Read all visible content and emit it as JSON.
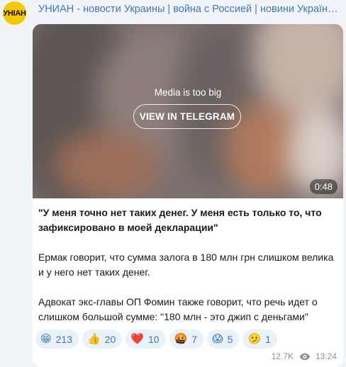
{
  "channel": {
    "name": "УНИАН - новости Украины | война с Россией | новини України...",
    "avatar_text": "УНІАН",
    "accent_color": "#3d7ab8",
    "avatar_color": "#f5c800"
  },
  "media": {
    "notice": "Media is too big",
    "button_label": "VIEW IN TELEGRAM",
    "duration": "0:48"
  },
  "post": {
    "paragraph1": "\"У меня точно нет таких денег. У меня есть только то, что зафиксировано в моей декларации\"",
    "paragraph2": "Ермак говорит, что сумма залога в 180 млн грн слишком велика и у него нет таких денег.",
    "paragraph3": "Адвокат экс-главы ОП Фомин также говорит, что речь идет о слишком большой сумме: \"180 млн - это джип с деньгами\""
  },
  "reactions": [
    {
      "icon": "😁",
      "icon_name": "grin-emoji",
      "count": "213"
    },
    {
      "icon": "👍",
      "icon_name": "thumbs-up-emoji",
      "count": "20"
    },
    {
      "icon": "❤️",
      "icon_name": "heart-emoji",
      "count": "10"
    },
    {
      "icon": "🤬",
      "icon_name": "angry-emoji",
      "count": "7"
    },
    {
      "icon": "😱",
      "icon_name": "scream-emoji",
      "count": "5"
    },
    {
      "icon": "🫤",
      "icon_name": "diagonal-mouth-emoji",
      "count": "1"
    }
  ],
  "meta": {
    "views": "12.7K",
    "time": "13:24"
  }
}
